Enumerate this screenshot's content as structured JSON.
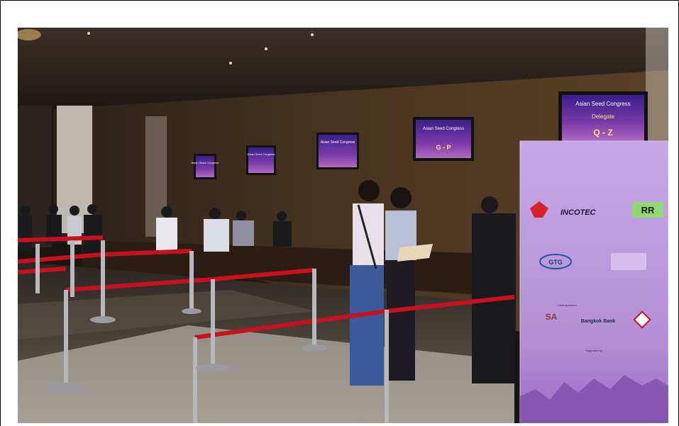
{
  "photo": {
    "screens": {
      "screen_1": "Asian Seed Congress",
      "screen_2": "Asian Seed Congress",
      "screen_3": "Asian Seed Congress",
      "screen_4_title": "Asian Seed Congress",
      "screen_4_range": "G - P",
      "screen_5_title": "Asian Seed Congress",
      "screen_5_sub": "Delegate",
      "screen_5_range": "Q - Z"
    },
    "banner": {
      "sponsor_incotec": "INCOTEC",
      "sponsor_rr": "RR",
      "sponsor_gtg": "GTG",
      "sponsor_bangkok_bank": "Bangkok Bank",
      "sponsor_sa": "SA",
      "local_sponsors_label": "Local sponsors",
      "supported_by_label": "Supported by"
    },
    "colors": {
      "banner_purple": "#b58fd8",
      "rope_red": "#c8101e",
      "screen_purple": "#6a2a9a"
    }
  }
}
